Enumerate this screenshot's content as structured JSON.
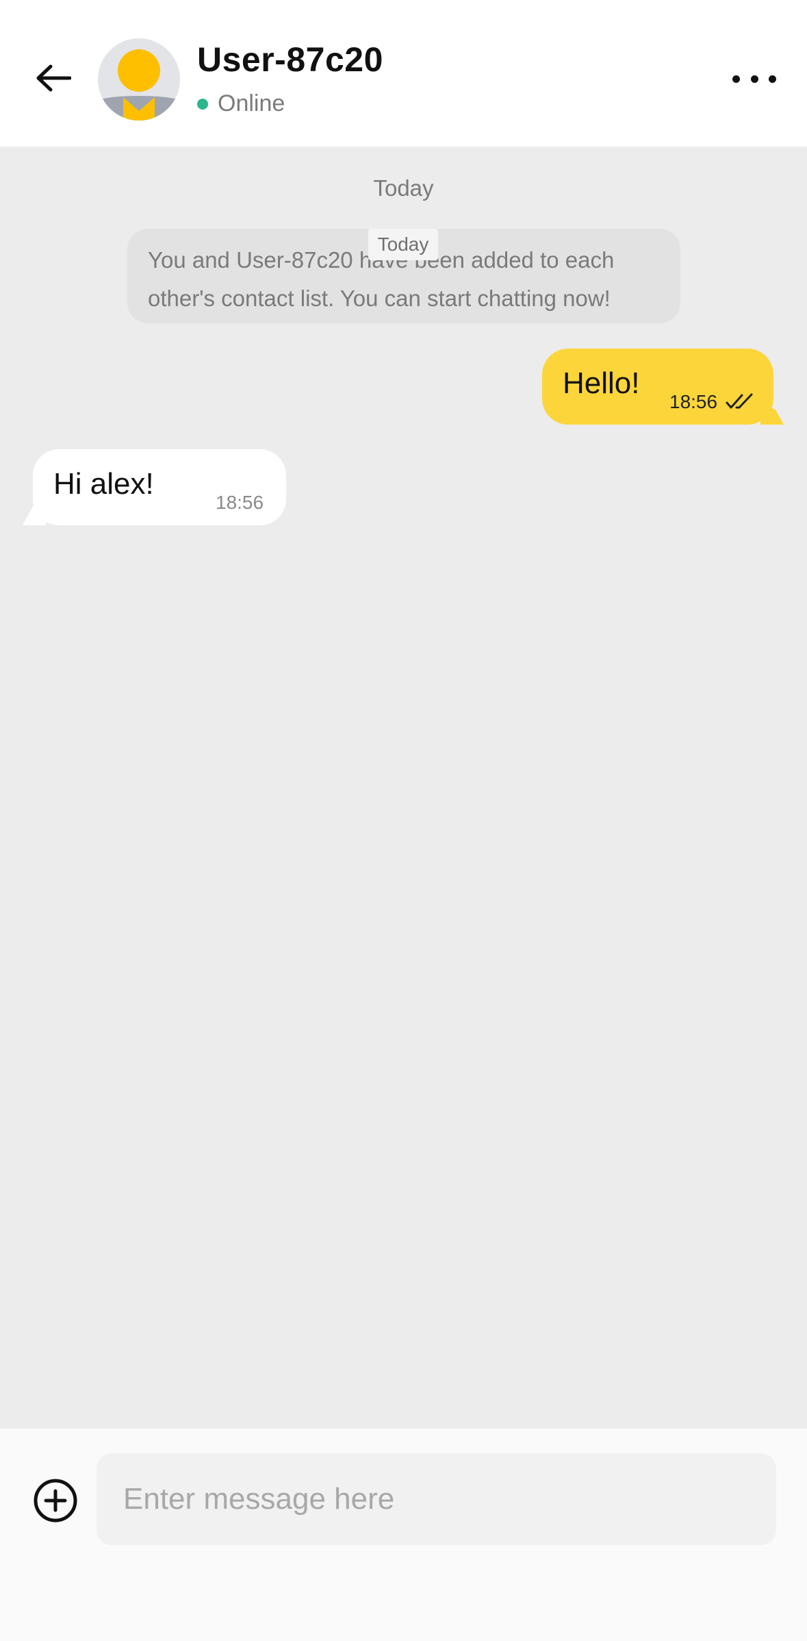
{
  "header": {
    "contact_name": "User-87c20",
    "status": "Online",
    "status_color": "#2bb68c"
  },
  "chat": {
    "date_label": "Today",
    "system_message": "You and User-87c20 have been added to each other's contact list. You can start chatting now!",
    "system_overlay_label": "Today",
    "messages": [
      {
        "direction": "outgoing",
        "text": "Hello!",
        "time": "18:56",
        "status": "read"
      },
      {
        "direction": "incoming",
        "text": "Hi alex!",
        "time": "18:56"
      }
    ]
  },
  "input": {
    "placeholder": "Enter message here",
    "value": ""
  },
  "colors": {
    "accent": "#fcd53a",
    "chat_background": "#ececec",
    "avatar_head": "#fdbf00",
    "avatar_body": "#9ea4b0"
  },
  "icons": {
    "back": "arrow-left-icon",
    "more": "more-horizontal-icon",
    "read_receipt": "double-check-icon",
    "attach": "plus-circle-icon"
  }
}
